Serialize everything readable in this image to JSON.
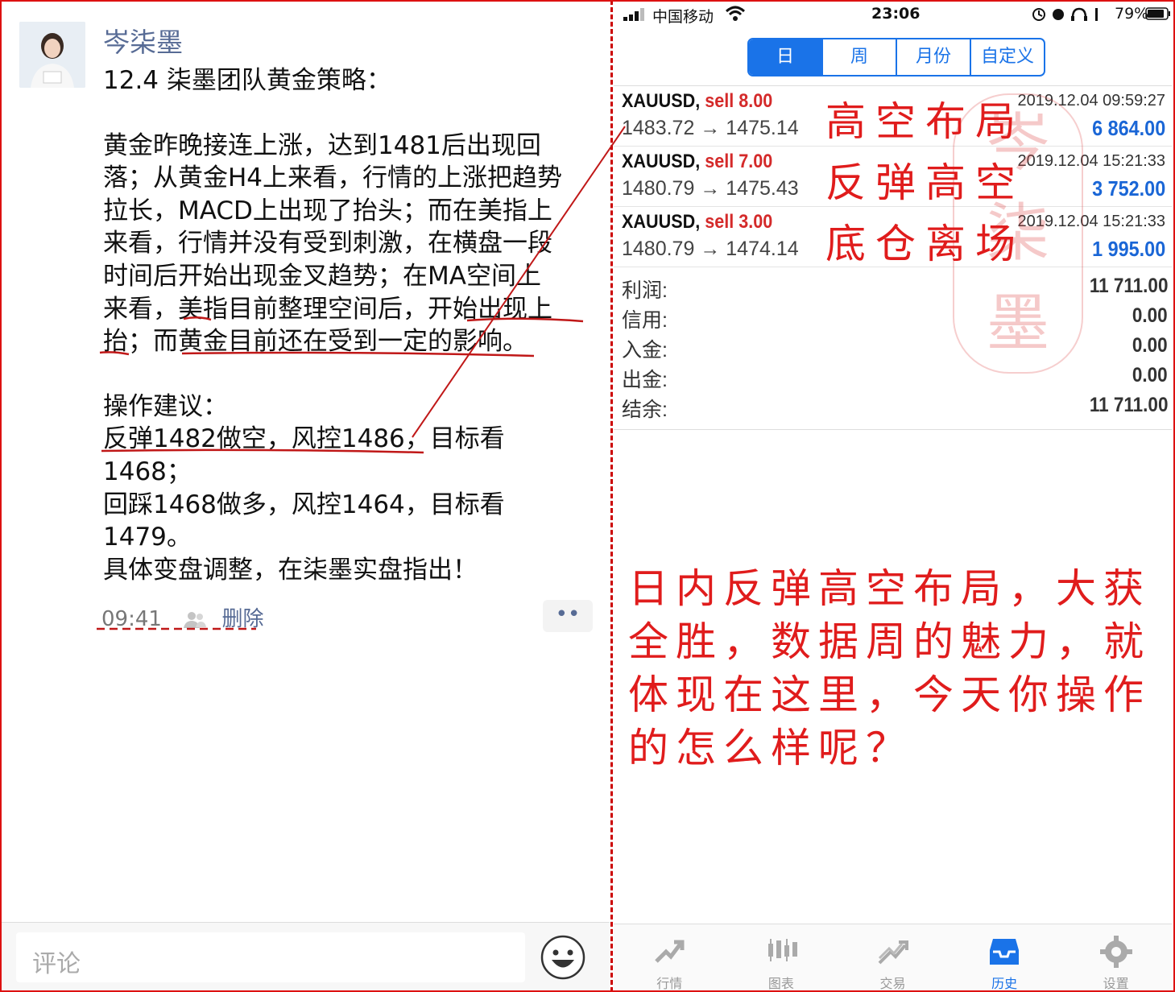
{
  "post": {
    "username": "岑柒墨",
    "lines": [
      "12.4 柒墨团队黄金策略：",
      "",
      "黄金昨晚接连上涨，达到1481后出现回",
      "落；从黄金H4上来看，行情的上涨把趋势",
      "拉长，MACD上出现了抬头；而在美指上",
      "来看，行情并没有受到刺激，在横盘一段",
      "时间后开始出现金叉趋势；在MA空间上",
      "来看，美指目前整理空间后，开始出现上",
      "抬；而黄金目前还在受到一定的影响。",
      "",
      "操作建议：",
      "反弹1482做空，风控1486，目标看",
      "1468；",
      "回踩1468做多，风控1464，目标看",
      "1479。",
      "具体变盘调整，在柒墨实盘指出！"
    ],
    "time": "09:41",
    "delete_label": "删除",
    "more_label": "••",
    "comment_placeholder": "评论"
  },
  "statusbar": {
    "carrier": "中国移动",
    "time": "23:06",
    "battery": "79%"
  },
  "period_tabs": [
    {
      "label": "日",
      "active": true
    },
    {
      "label": "周",
      "active": false
    },
    {
      "label": "月份",
      "active": false
    },
    {
      "label": "自定义",
      "active": false
    }
  ],
  "trades": [
    {
      "symbol": "XAUUSD,",
      "side": "sell 8.00",
      "prices": "1483.72 → 1475.14",
      "date": "2019.12.04 09:59:27",
      "profit": "6 864.00"
    },
    {
      "symbol": "XAUUSD,",
      "side": "sell 7.00",
      "prices": "1480.79 → 1475.43",
      "date": "2019.12.04 15:21:33",
      "profit": "3 752.00"
    },
    {
      "symbol": "XAUUSD,",
      "side": "sell 3.00",
      "prices": "1480.79 → 1474.14",
      "date": "2019.12.04 15:21:33",
      "profit": "1 995.00"
    }
  ],
  "summary": [
    {
      "label": "利润:",
      "value": "11 711.00"
    },
    {
      "label": "信用:",
      "value": "0.00"
    },
    {
      "label": "入金:",
      "value": "0.00"
    },
    {
      "label": "出金:",
      "value": "0.00"
    },
    {
      "label": "结余:",
      "value": "11 711.00"
    }
  ],
  "tabbar": [
    {
      "label": "行情",
      "icon": "quotes-icon",
      "active": false
    },
    {
      "label": "图表",
      "icon": "chart-icon",
      "active": false
    },
    {
      "label": "交易",
      "icon": "trade-icon",
      "active": false
    },
    {
      "label": "历史",
      "icon": "history-icon",
      "active": true
    },
    {
      "label": "设置",
      "icon": "settings-icon",
      "active": false
    }
  ],
  "annotations": {
    "side": [
      "高空布局",
      "反弹高空",
      "底仓离场"
    ],
    "main": "日内反弹高空布局，大获全胜，数据周的魅力，就体现在这里，今天你操作的怎么样呢？",
    "seal": [
      "岑",
      "柒",
      "墨"
    ]
  },
  "colors": {
    "annotation_red": "#e01c1c",
    "accent_blue": "#1a73e8",
    "profit_blue": "#1a66d6",
    "link_blue": "#576b95"
  }
}
